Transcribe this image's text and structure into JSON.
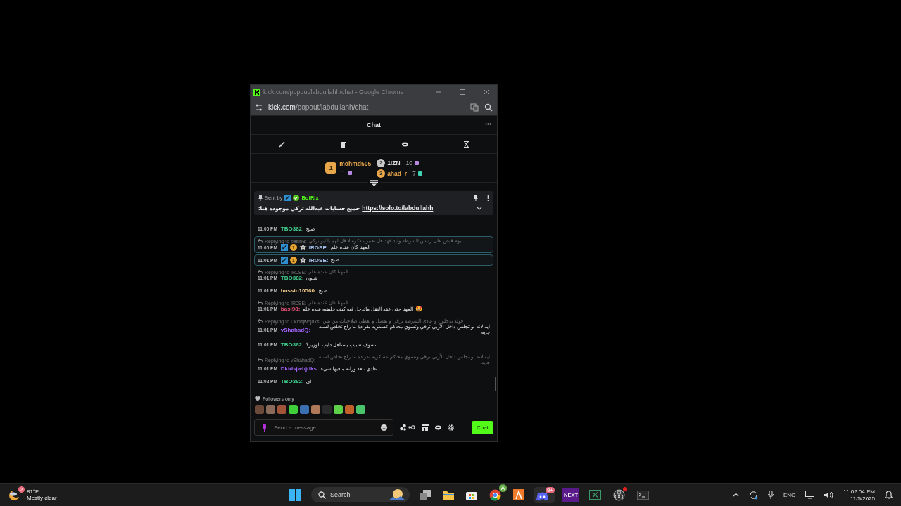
{
  "window": {
    "title": "kick.com/popout/labdullahh/chat - Google Chrome",
    "address_host": "kick.com",
    "address_path": "/popout/labdullahh/chat"
  },
  "chat_header": {
    "title": "Chat"
  },
  "leaderboard": [
    {
      "rank": "1",
      "name": "mohmd505",
      "count": "11",
      "color": "#e8a64a"
    },
    {
      "rank": "2",
      "name": "1IZN",
      "count": "10",
      "color": "#c8c8c8"
    },
    {
      "rank": "3",
      "name": "ahad_r",
      "count": "7",
      "color": "#e8a64a"
    }
  ],
  "pinned": {
    "sent_by": "Sent by",
    "bot": "BotRix",
    "text": "جميع حسابات عبدالله تركي موجوده هنا:",
    "link": "https://solo.to/labdullahh"
  },
  "messages": [
    {
      "time": "11:00 PM",
      "user": "TBO382:",
      "color": "#3fd18f",
      "text": "صبح",
      "highlighted": false
    },
    {
      "reply_label": "Replying to basl98:",
      "reply_text": "يوم قبض على رئيس الشرطه وليد فهد هل تعتبر مذكره لا قل لهم يا ابو تركي",
      "time": "11:00 PM",
      "user": "IROSE:",
      "color": "#a9c4ee",
      "text": "المهنا كان عنده علم",
      "highlighted": true,
      "badges": [
        {
          "kind": "moderator"
        },
        {
          "kind": "sub",
          "label": "1"
        },
        {
          "kind": "crest"
        }
      ]
    },
    {
      "time": "11:01 PM",
      "user": "IROSE:",
      "color": "#a9c4ee",
      "text": "صبح",
      "highlighted": true,
      "badges": [
        {
          "kind": "moderator"
        },
        {
          "kind": "sub",
          "label": "1"
        },
        {
          "kind": "crest"
        }
      ]
    },
    {
      "reply_label": "Replying to IR0SE:",
      "reply_text": "المهنا كان عنده علم",
      "time": "11:01 PM",
      "user": "TBO382:",
      "color": "#3fd18f",
      "text": "شلون",
      "highlighted": false
    },
    {
      "time": "11:01 PM",
      "user": "hussin10560:",
      "color": "#f0c98a",
      "text": "صبح",
      "highlighted": false
    },
    {
      "reply_label": "Replying to IR0SE:",
      "reply_text": "المهنا كان عنده علم",
      "time": "11:01 PM",
      "user": "basl98:",
      "color": "#e8527a",
      "text": "المهنا حتى عقد النقل ماتدخل فيه كيف خليفيه عنده علم",
      "emoji": "🤩",
      "highlighted": false
    },
    {
      "reply_label": "Replying to Dkidsjwbjdks:",
      "reply_text": "فوله يدخلون و عادي الشرطه ترقي و تفصل و تعطي صلاحيات من نس",
      "time": "11:01 PM",
      "user": "vShahadQ:",
      "color": "#a565ff",
      "text": "ايه لانه لو تجلس داخل الأربي ترقي وتسوي محاكم عسكريه بقرادة ما راح تخلص لسنه جايه",
      "highlighted": false
    },
    {
      "time": "11:01 PM",
      "user": "TBO382:",
      "color": "#3fd18f",
      "text": "تشوف شبيب يستاهل دايب الوزير؟",
      "highlighted": false
    },
    {
      "reply_label": "Replying to vShahadQ:",
      "reply_text": "ايه لانه لو تجلس داخل الأربي ترقي وتسوي محاكم عسكريه بقرادة ما راح تخلص لسنه جايه",
      "time": "11:01 PM",
      "user": "Dkidsjwbjdks:",
      "color": "#a565ff",
      "text": "عادي تلعد ورانه مافيها شيء",
      "highlighted": false
    },
    {
      "time": "11:02 PM",
      "user": "TBO382:",
      "color": "#3fd18f",
      "text": "اي",
      "highlighted": false
    }
  ],
  "followers_only": "Followers only",
  "emotes": [
    {
      "color": "#6b4a3a"
    },
    {
      "color": "#8a6a5a"
    },
    {
      "color": "#a0553a"
    },
    {
      "color": "#3fcf3a"
    },
    {
      "color": "#3a6fb0"
    },
    {
      "color": "#b07a5a"
    },
    {
      "color": "#2a2a2a"
    },
    {
      "color": "#5fd04a"
    },
    {
      "color": "#c0602a"
    },
    {
      "color": "#49c46a"
    }
  ],
  "composer": {
    "placeholder": "Send a message",
    "send": "Chat"
  },
  "taskbar": {
    "weather_badge": "2",
    "temperature": "81°F",
    "condition": "Mostly clear",
    "search": "Search",
    "chrome_badge": "A",
    "discord_badge": "9+",
    "next_label": "NEXT",
    "language": "ENG",
    "time": "11:02:04 PM",
    "date": "11/5/2025"
  }
}
